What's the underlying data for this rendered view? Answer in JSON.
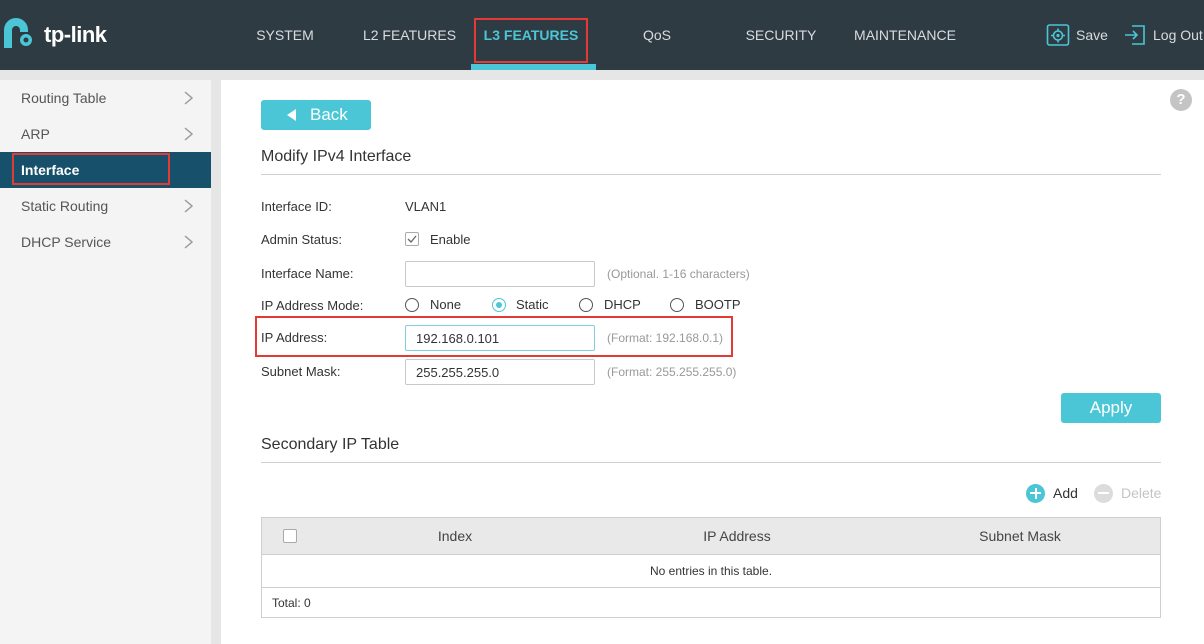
{
  "brand": {
    "logo_text": "tp-link",
    "accent": "#4bc6d6",
    "header_bg": "#2f3b43",
    "sidebar_active_bg": "#17506a",
    "highlight": "#e53935"
  },
  "nav": {
    "items": [
      {
        "label": "SYSTEM"
      },
      {
        "label": "L2 FEATURES"
      },
      {
        "label": "L3 FEATURES",
        "active": true
      },
      {
        "label": "QoS"
      },
      {
        "label": "SECURITY"
      },
      {
        "label": "MAINTENANCE"
      }
    ],
    "save_label": "Save",
    "logout_label": "Log Out"
  },
  "sidebar": {
    "items": [
      {
        "label": "Routing Table"
      },
      {
        "label": "ARP"
      },
      {
        "label": "Interface",
        "active": true
      },
      {
        "label": "Static Routing"
      },
      {
        "label": "DHCP Service"
      }
    ]
  },
  "page": {
    "help_glyph": "?",
    "back_label": "Back",
    "section_title": "Modify IPv4 Interface",
    "fields": {
      "interface_id": {
        "label": "Interface ID:",
        "value": "VLAN1"
      },
      "admin_status": {
        "label": "Admin Status:",
        "option": "Enable",
        "checked": true
      },
      "interface_name": {
        "label": "Interface Name:",
        "value": "",
        "hint": "(Optional. 1-16 characters)"
      },
      "ip_mode": {
        "label": "IP Address Mode:",
        "options": [
          "None",
          "Static",
          "DHCP",
          "BOOTP"
        ],
        "selected": "Static"
      },
      "ip_address": {
        "label": "IP Address:",
        "value": "192.168.0.101",
        "hint": "(Format: 192.168.0.1)"
      },
      "subnet_mask": {
        "label": "Subnet Mask:",
        "value": "255.255.255.0",
        "hint": "(Format: 255.255.255.0)"
      }
    },
    "apply_label": "Apply"
  },
  "secondary_table": {
    "title": "Secondary IP Table",
    "add_label": "Add",
    "delete_label": "Delete",
    "columns": [
      "Index",
      "IP Address",
      "Subnet Mask"
    ],
    "empty_text": "No entries in this table.",
    "total_label": "Total: 0"
  }
}
